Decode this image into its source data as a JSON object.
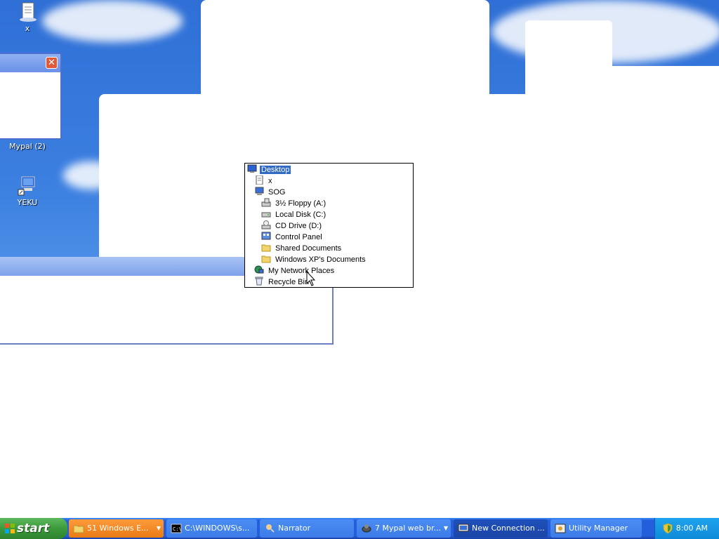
{
  "desktop": {
    "icons": [
      {
        "label": "x"
      },
      {
        "label": "Mypal (2)"
      },
      {
        "label": "YEKU"
      }
    ]
  },
  "tree": {
    "items": [
      {
        "label": "Desktop",
        "icon": "desktop-icon",
        "selected": true
      },
      {
        "label": "x",
        "icon": "document-icon"
      },
      {
        "label": "SOG",
        "icon": "computer-icon"
      },
      {
        "label": "3½ Floppy (A:)",
        "icon": "floppy-drive-icon"
      },
      {
        "label": "Local Disk (C:)",
        "icon": "hard-disk-icon"
      },
      {
        "label": "CD Drive (D:)",
        "icon": "cd-drive-icon"
      },
      {
        "label": "Control Panel",
        "icon": "control-panel-icon"
      },
      {
        "label": "Shared Documents",
        "icon": "folder-icon"
      },
      {
        "label": "Windows XP's Documents",
        "icon": "folder-icon"
      },
      {
        "label": "My Network Places",
        "icon": "network-places-icon"
      },
      {
        "label": "Recycle Bin",
        "icon": "recycle-bin-icon"
      }
    ]
  },
  "taskbar": {
    "start_label": "start",
    "tasks": [
      {
        "label": "51 Windows E...",
        "icon": "folder-icon",
        "style": "orange",
        "has_arrow": true
      },
      {
        "label": "C:\\WINDOWS\\s...",
        "icon": "console-icon"
      },
      {
        "label": "Narrator",
        "icon": "narrator-icon"
      },
      {
        "label": "7 Mypal web br...",
        "icon": "browser-icon",
        "has_arrow": true
      },
      {
        "label": "New Connection ...",
        "icon": "connection-icon",
        "active": true
      },
      {
        "label": "Utility Manager",
        "icon": "utility-manager-icon"
      }
    ],
    "clock": "8:00 AM"
  },
  "colors": {
    "selection": "#316ac5",
    "taskbar": "#245edb",
    "start_button": "#3c9a3c",
    "tray": "#0f8ad8"
  }
}
